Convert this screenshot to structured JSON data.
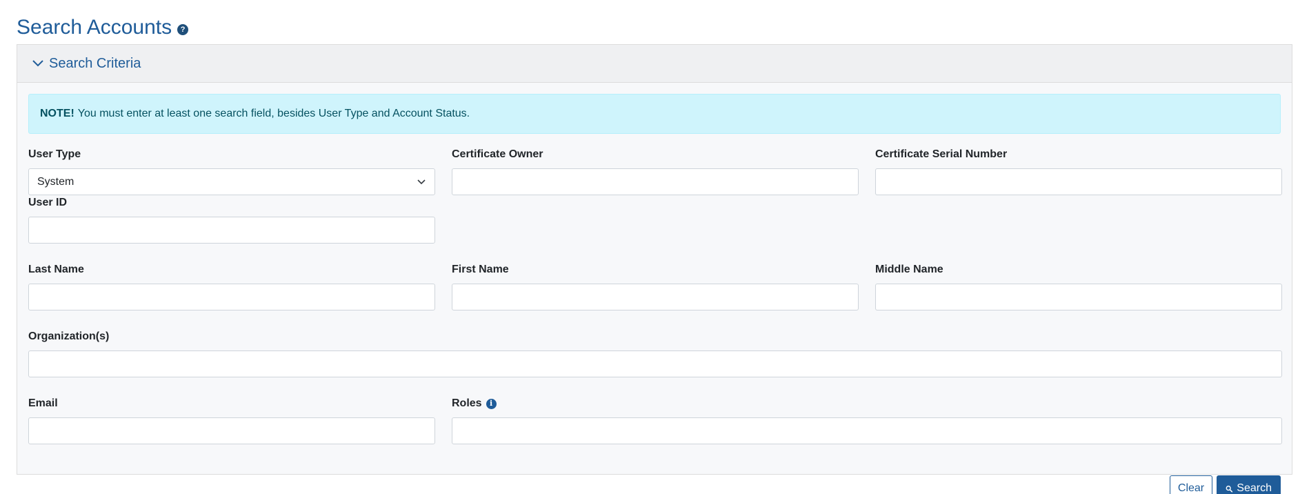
{
  "page": {
    "title": "Search Accounts",
    "help_icon": "question-circle-icon"
  },
  "search_criteria": {
    "title": "Search Criteria",
    "collapse_icon": "chevron-down-icon",
    "note": {
      "strong": "NOTE!",
      "text": "You must enter at least one search field, besides User Type and Account Status."
    },
    "fields": {
      "user_type": {
        "label": "User Type",
        "value": "System"
      },
      "certificate_owner": {
        "label": "Certificate Owner",
        "value": ""
      },
      "certificate_serial_number": {
        "label": "Certificate Serial Number",
        "value": ""
      },
      "user_id": {
        "label": "User ID",
        "value": ""
      },
      "last_name": {
        "label": "Last Name",
        "value": ""
      },
      "first_name": {
        "label": "First Name",
        "value": ""
      },
      "middle_name": {
        "label": "Middle Name",
        "value": ""
      },
      "organizations": {
        "label": "Organization(s)",
        "value": ""
      },
      "email": {
        "label": "Email",
        "value": ""
      },
      "roles": {
        "label": "Roles",
        "value": "",
        "info_icon": "info-circle-icon"
      }
    },
    "buttons": {
      "clear": "Clear",
      "search": "Search"
    }
  },
  "colors": {
    "brand_blue": "#1f5c99",
    "note_bg": "#cff4fc",
    "note_text": "#055160"
  }
}
